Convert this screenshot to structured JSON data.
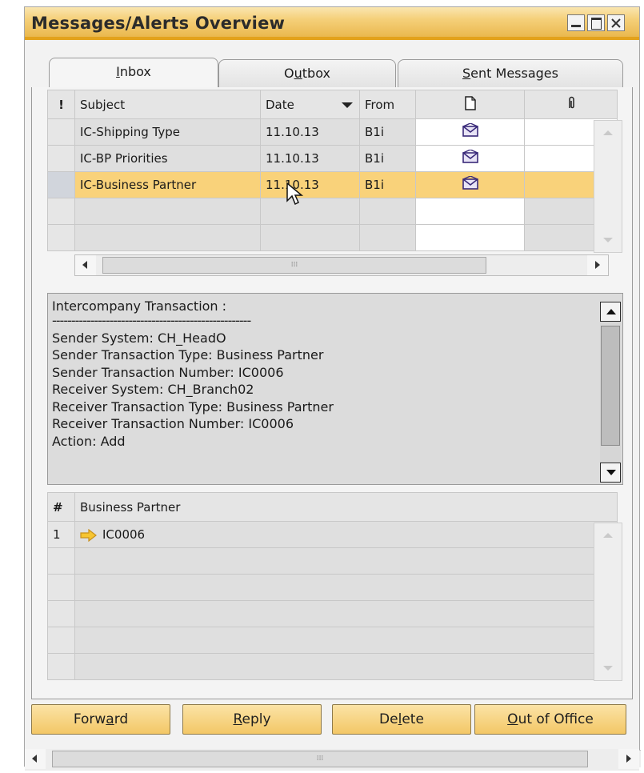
{
  "window": {
    "title": "Messages/Alerts Overview"
  },
  "tabs": [
    {
      "pre": "",
      "u": "I",
      "post": "nbox"
    },
    {
      "pre": "O",
      "u": "u",
      "post": "tbox"
    },
    {
      "pre": "",
      "u": "S",
      "post": "ent Messages"
    }
  ],
  "messages": {
    "headers": {
      "priority": "!",
      "subject": "Subject",
      "date": "Date",
      "from": "From"
    },
    "rows": [
      {
        "subject": "IC-Shipping Type",
        "date": "11.10.13",
        "from": "B1i"
      },
      {
        "subject": "IC-BP Priorities",
        "date": "11.10.13",
        "from": "B1i"
      },
      {
        "subject": "IC-Business Partner",
        "date": "11.10.13",
        "from": "B1i"
      }
    ]
  },
  "message_body": {
    "lines": [
      "Intercompany Transaction :",
      "----------------------------------------------------",
      "Sender System: CH_HeadO",
      "Sender Transaction Type: Business Partner",
      "Sender Transaction Number: IC0006",
      "Receiver System: CH_Branch02",
      "Receiver Transaction Type: Business Partner",
      "Receiver Transaction Number: IC0006",
      "Action: Add"
    ]
  },
  "detail": {
    "headers": {
      "num": "#",
      "partner": "Business Partner"
    },
    "rows": [
      {
        "num": "1",
        "partner": "IC0006"
      }
    ]
  },
  "buttons": [
    {
      "pre": "Forw",
      "u": "a",
      "post": "rd"
    },
    {
      "pre": "",
      "u": "R",
      "post": "eply"
    },
    {
      "pre": "De",
      "u": "l",
      "post": "ete"
    },
    {
      "pre": "",
      "u": "O",
      "post": "ut of Office"
    }
  ],
  "colors": {
    "accent": "#f5c45e",
    "selected_row": "#f9d27a",
    "title_bar": "#f5d07a"
  },
  "icons": {
    "new_doc": "page-icon",
    "attachment": "paperclip-icon",
    "read": "envelope-icon",
    "link_arrow": "arrow-right-icon"
  }
}
